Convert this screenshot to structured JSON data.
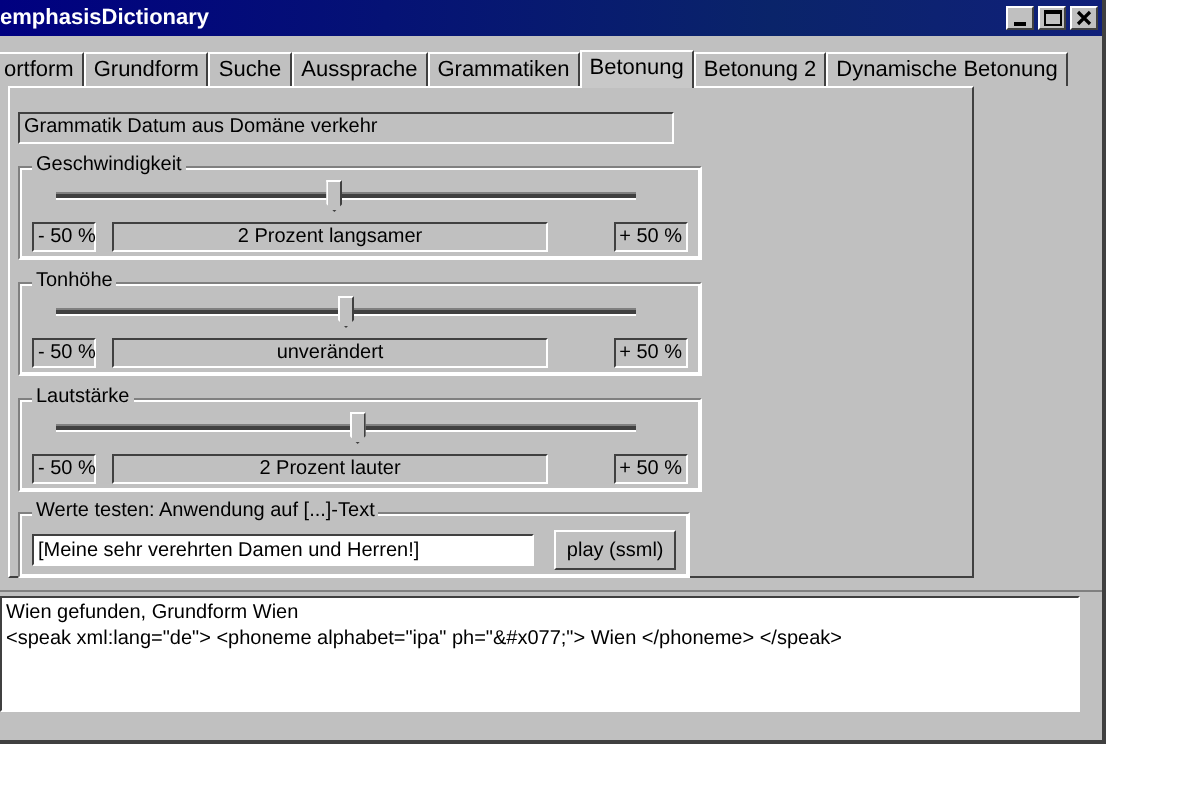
{
  "window": {
    "title": "emphasisDictionary"
  },
  "tabs": [
    {
      "label": "ortform",
      "selected": false
    },
    {
      "label": "Grundform",
      "selected": false
    },
    {
      "label": "Suche",
      "selected": false
    },
    {
      "label": "Aussprache",
      "selected": false
    },
    {
      "label": "Grammatiken",
      "selected": false
    },
    {
      "label": "Betonung",
      "selected": true
    },
    {
      "label": "Betonung 2",
      "selected": false
    },
    {
      "label": "Dynamische Betonung",
      "selected": false
    }
  ],
  "grammar_field": {
    "value": "Grammatik Datum aus Domäne verkehr"
  },
  "sliders": [
    {
      "label": "Geschwindigkeit",
      "level": 0.48,
      "min": "- 50 %",
      "reading": "2 Prozent langsamer",
      "max": "+ 50 %"
    },
    {
      "label": "Tonhöhe",
      "level": 0.5,
      "min": "- 50 %",
      "reading": "unverändert",
      "max": "+ 50 %"
    },
    {
      "label": "Lautstärke",
      "level": 0.52,
      "min": "- 50 %",
      "reading": "2 Prozent lauter",
      "max": "+ 50 %"
    }
  ],
  "test": {
    "label": "Werte testen: Anwendung auf [...]-Text",
    "value": "[Meine sehr verehrten Damen und Herren!]",
    "button": "play (ssml)"
  },
  "output": [
    "Wien gefunden, Grundform Wien",
    "<speak xml:lang=\"de\"> <phoneme alphabet=\"ipa\" ph=\"&#x077;\"> Wien </phoneme> </speak>"
  ]
}
